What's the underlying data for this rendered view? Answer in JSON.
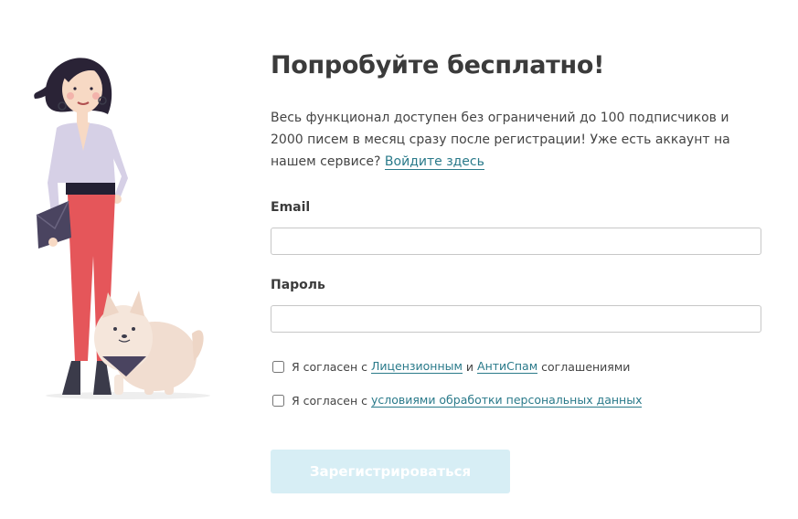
{
  "heading": "Попробуйте бесплатно!",
  "intro": {
    "text": "Весь функционал доступен без ограничений до 100 подписчиков и 2000 писем в месяц сразу после регистрации! Уже есть аккаунт на нашем сервисе?",
    "login_link": "Войдите здесь"
  },
  "email": {
    "label": "Email",
    "value": ""
  },
  "password": {
    "label": "Пароль",
    "value": ""
  },
  "agreement1": {
    "prefix": "Я согласен с",
    "link1": "Лицензионным",
    "middle": "и",
    "link2": "АнтиСпам",
    "suffix": "соглашениями",
    "checked": false
  },
  "agreement2": {
    "prefix": "Я согласен с",
    "link": "условиями обработки персональных данных",
    "checked": false
  },
  "submit_label": "Зарегистрироваться",
  "colors": {
    "link": "#2a7a8a",
    "button_bg": "#d7eef5",
    "pants": "#e5565a",
    "blouse": "#d6d0e6",
    "hair": "#2a2336"
  },
  "illustration": "woman-with-dog-illustration"
}
